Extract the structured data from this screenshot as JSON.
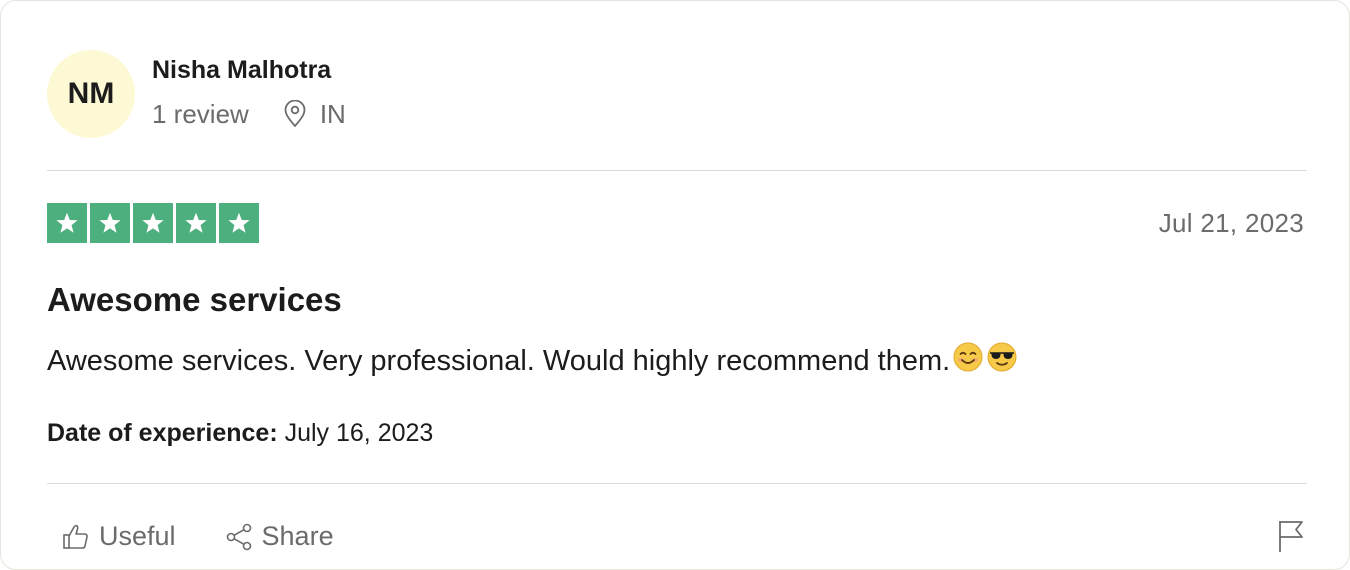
{
  "consumer": {
    "initials": "NM",
    "name": "Nisha Malhotra",
    "review_count": "1 review",
    "country": "IN"
  },
  "review": {
    "rating": 5,
    "rating_max": 5,
    "date_published": "Jul 21, 2023",
    "title": "Awesome services",
    "text": "Awesome services. Very professional. Would highly recommend them.",
    "emojis": [
      "smiling-face-emoji",
      "sunglasses-face-emoji"
    ],
    "experience_label": "Date of experience:",
    "experience_date": "July 16, 2023"
  },
  "actions": {
    "useful_label": "Useful",
    "share_label": "Share"
  },
  "colors": {
    "star_green": "#4caf7d",
    "avatar_bg": "#fdf9d4",
    "muted_text": "#6b6b6b"
  }
}
